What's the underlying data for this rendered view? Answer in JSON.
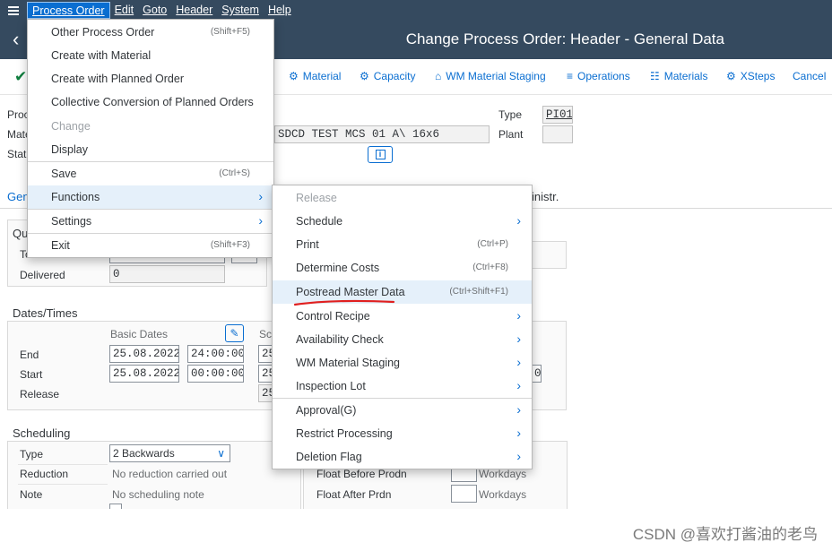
{
  "menubar": {
    "items": [
      "Process Order",
      "Edit",
      "Goto",
      "Header",
      "System",
      "Help"
    ]
  },
  "titlebar": {
    "title": "Change Process Order: Header - General Data"
  },
  "toolbar": {
    "buttons": [
      {
        "icon": "material-icon",
        "label": "Material"
      },
      {
        "icon": "capacity-icon",
        "label": "Capacity"
      },
      {
        "icon": "wm-staging-icon",
        "label": "WM Material Staging"
      },
      {
        "icon": "operations-icon",
        "label": "Operations"
      },
      {
        "icon": "materials-icon",
        "label": "Materials"
      },
      {
        "icon": "xsteps-icon",
        "label": "XSteps"
      },
      {
        "icon": "",
        "label": "Cancel"
      }
    ]
  },
  "header_form": {
    "proc_label": "Proc",
    "mate_label": "Mate",
    "stat_label": "Stat",
    "material_desc": "SDCD TEST MCS 01 A\\ 16x6",
    "type_label": "Type",
    "type_value": "PI01",
    "plant_label": "Plant",
    "tab_gen": "Gen",
    "tab_admin": "inistr."
  },
  "quantities": {
    "section_prefix": "Qu",
    "total_label": "To",
    "delivered_label": "Delivered",
    "delivered_value": "0"
  },
  "dates": {
    "section": "Dates/Times",
    "basic_dates_label": "Basic Dates",
    "sched_prefix": "Sc",
    "end_label": "End",
    "end_date": "25.08.2022",
    "end_time": "24:00:00",
    "start_label": "Start",
    "start_date": "25.08.2022",
    "start_time": "00:00:00",
    "release_label": "Release",
    "col_prefix": "25",
    "right_field_fragment": "0"
  },
  "scheduling": {
    "section": "Scheduling",
    "type_label": "Type",
    "type_value": "2 Backwards",
    "reduction_label": "Reduction",
    "reduction_value": "No reduction carried out",
    "note_label": "Note",
    "note_value": "No scheduling note",
    "float_before_label": "Float Before Prodn",
    "float_after_label": "Float After Prdn",
    "workdays": "Workdays"
  },
  "menu_process_order": {
    "items": [
      {
        "label": "Other Process Order",
        "shortcut": "(Shift+F5)"
      },
      {
        "label": "Create with Material",
        "shortcut": ""
      },
      {
        "label": "Create with Planned Order",
        "shortcut": ""
      },
      {
        "label": "Collective Conversion of Planned Orders",
        "shortcut": ""
      },
      {
        "label": "Change",
        "shortcut": ""
      },
      {
        "label": "Display",
        "shortcut": ""
      },
      {
        "label": "Save",
        "shortcut": "(Ctrl+S)"
      },
      {
        "label": "Functions",
        "shortcut": ""
      },
      {
        "label": "Settings",
        "shortcut": ""
      },
      {
        "label": "Exit",
        "shortcut": "(Shift+F3)"
      }
    ]
  },
  "menu_functions": {
    "items": [
      {
        "label": "Release",
        "shortcut": ""
      },
      {
        "label": "Schedule",
        "shortcut": ""
      },
      {
        "label": "Print",
        "shortcut": "(Ctrl+P)"
      },
      {
        "label": "Determine Costs",
        "shortcut": "(Ctrl+F8)"
      },
      {
        "label": "Postread Master Data",
        "shortcut": "(Ctrl+Shift+F1)"
      },
      {
        "label": "Control Recipe",
        "shortcut": ""
      },
      {
        "label": "Availability Check",
        "shortcut": ""
      },
      {
        "label": "WM Material Staging",
        "shortcut": ""
      },
      {
        "label": "Inspection Lot",
        "shortcut": ""
      },
      {
        "label": "Approval(G)",
        "shortcut": ""
      },
      {
        "label": "Restrict Processing",
        "shortcut": ""
      },
      {
        "label": "Deletion Flag",
        "shortcut": ""
      }
    ]
  },
  "watermark": "CSDN @喜欢打酱油的老鸟",
  "colors": {
    "shell": "#354a5f",
    "accent": "#0a6ed1",
    "hover": "#e5f0fa",
    "annotation": "#e02020"
  }
}
